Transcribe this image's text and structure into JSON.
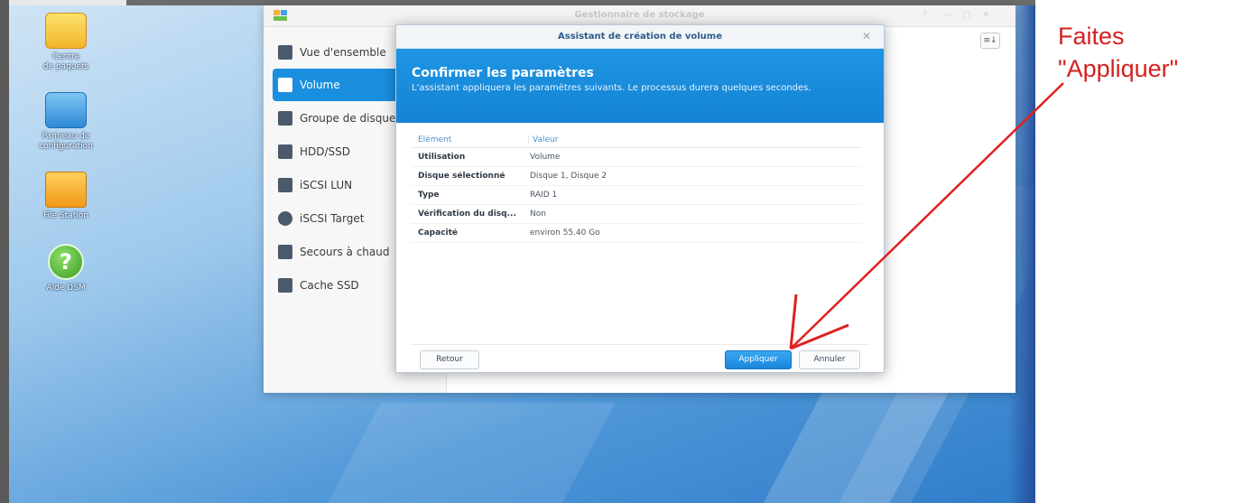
{
  "desktop": {
    "icons": [
      {
        "label_line1": "Centre",
        "label_line2": "de paquets"
      },
      {
        "label_line1": "Panneau de",
        "label_line2": "configuration"
      },
      {
        "label_line1": "File Station",
        "label_line2": ""
      },
      {
        "label_line1": "Aide DSM",
        "label_line2": ""
      }
    ]
  },
  "window": {
    "title": "Gestionnaire de stockage",
    "controls": [
      "?",
      "—",
      "□",
      "✕"
    ],
    "sidebar": [
      {
        "label": "Vue d'ensemble",
        "icon": "overview-icon"
      },
      {
        "label": "Volume",
        "icon": "volume-icon"
      },
      {
        "label": "Groupe de disque",
        "icon": "disk-group-icon"
      },
      {
        "label": "HDD/SSD",
        "icon": "hdd-icon"
      },
      {
        "label": "iSCSI LUN",
        "icon": "database-icon"
      },
      {
        "label": "iSCSI Target",
        "icon": "target-icon"
      },
      {
        "label": "Secours à chaud",
        "icon": "hot-spare-icon"
      },
      {
        "label": "Cache SSD",
        "icon": "ssd-cache-icon"
      }
    ],
    "active_item": "Volume",
    "toolbar_button": "≡↓"
  },
  "dialog": {
    "title": "Assistant de création de volume",
    "close": "✕",
    "heading": "Confirmer les paramètres",
    "description": "L'assistant appliquera les paramètres suivants. Le processus durera quelques secondes.",
    "table": {
      "headers": [
        "Élément",
        "Valeur"
      ],
      "rows": [
        [
          "Utilisation",
          "Volume"
        ],
        [
          "Disque sélectionné",
          "Disque 1, Disque 2"
        ],
        [
          "Type",
          "RAID 1"
        ],
        [
          "Vérification du disq...",
          "Non"
        ],
        [
          "Capacité",
          "environ 55.40 Go"
        ]
      ]
    },
    "buttons": {
      "back": "Retour",
      "apply": "Appliquer",
      "cancel": "Annuler"
    }
  },
  "annotation": {
    "line1": "Faites",
    "line2": "\"Appliquer\"",
    "color": "#d61f1f"
  },
  "colors": {
    "accent": "#1a8fe0",
    "header_blue": "#1583d4"
  }
}
